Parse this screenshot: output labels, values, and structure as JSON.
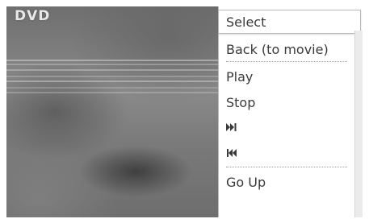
{
  "screen": {
    "title": "DVD"
  },
  "menu": {
    "items": [
      {
        "label": "Select",
        "selected": true
      },
      {
        "label": "Back (to movie)",
        "selected": false
      },
      {
        "label": "Play",
        "selected": false
      },
      {
        "label": "Stop",
        "selected": false
      },
      {
        "label": "",
        "icon": "skip-next-icon",
        "selected": false
      },
      {
        "label": "",
        "icon": "skip-previous-icon",
        "selected": false
      },
      {
        "label": "Go Up",
        "selected": false
      }
    ]
  },
  "colors": {
    "menu_text": "#3a3a3a",
    "menu_background": "#ffffff",
    "video_background": "#7e7e7e"
  }
}
